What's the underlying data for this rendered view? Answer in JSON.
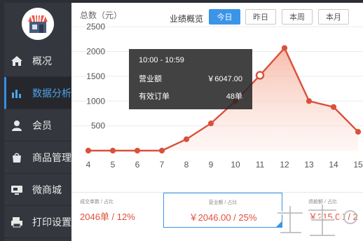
{
  "sidebar": {
    "items": [
      {
        "label": "概况",
        "icon": "home-icon",
        "active": false
      },
      {
        "label": "数据分析",
        "icon": "bar-chart-icon",
        "active": true
      },
      {
        "label": "会员",
        "icon": "person-icon",
        "active": false
      },
      {
        "label": "商品管理",
        "icon": "shopping-bag-icon",
        "active": false
      },
      {
        "label": "微商城",
        "icon": "store-screen-icon",
        "active": false
      },
      {
        "label": "打印设置",
        "icon": "printer-icon",
        "active": false
      }
    ]
  },
  "header": {
    "total_label": "总数（元）",
    "overview_label": "业绩概览",
    "tabs": [
      "今日",
      "昨日",
      "本周",
      "本月"
    ],
    "active_tab": "今日"
  },
  "tooltip": {
    "time_range": "10:00 - 10:59",
    "rows": [
      {
        "label": "营业额",
        "value": "￥6047.00"
      },
      {
        "label": "有效订单",
        "value": "48单"
      }
    ]
  },
  "stats": [
    {
      "caption": "成交单数 / 占比",
      "value": "2046单 / 12%"
    },
    {
      "caption": "营业额 / 占比",
      "value": "￥2046.00 / 25%"
    },
    {
      "caption": "退款额 / 占比",
      "value": "￥215.00 / 2"
    }
  ],
  "colors": {
    "accent": "#3a94e8",
    "line": "#d9503c",
    "area": "#fbd9cf",
    "sidebar": "#34373e"
  },
  "chart_data": {
    "type": "area",
    "x": [
      4,
      5,
      6,
      7,
      8,
      9,
      10,
      11,
      12,
      13,
      14,
      15
    ],
    "series": [
      {
        "values": [
          0,
          0,
          0,
          0,
          230,
          550,
          1000,
          1520,
          2070,
          1000,
          880,
          380
        ]
      }
    ],
    "y_ticks": [
      500,
      1000,
      1500,
      2000,
      2500
    ],
    "ylim": [
      0,
      2700
    ],
    "highlight_x": 11,
    "grid": true
  }
}
